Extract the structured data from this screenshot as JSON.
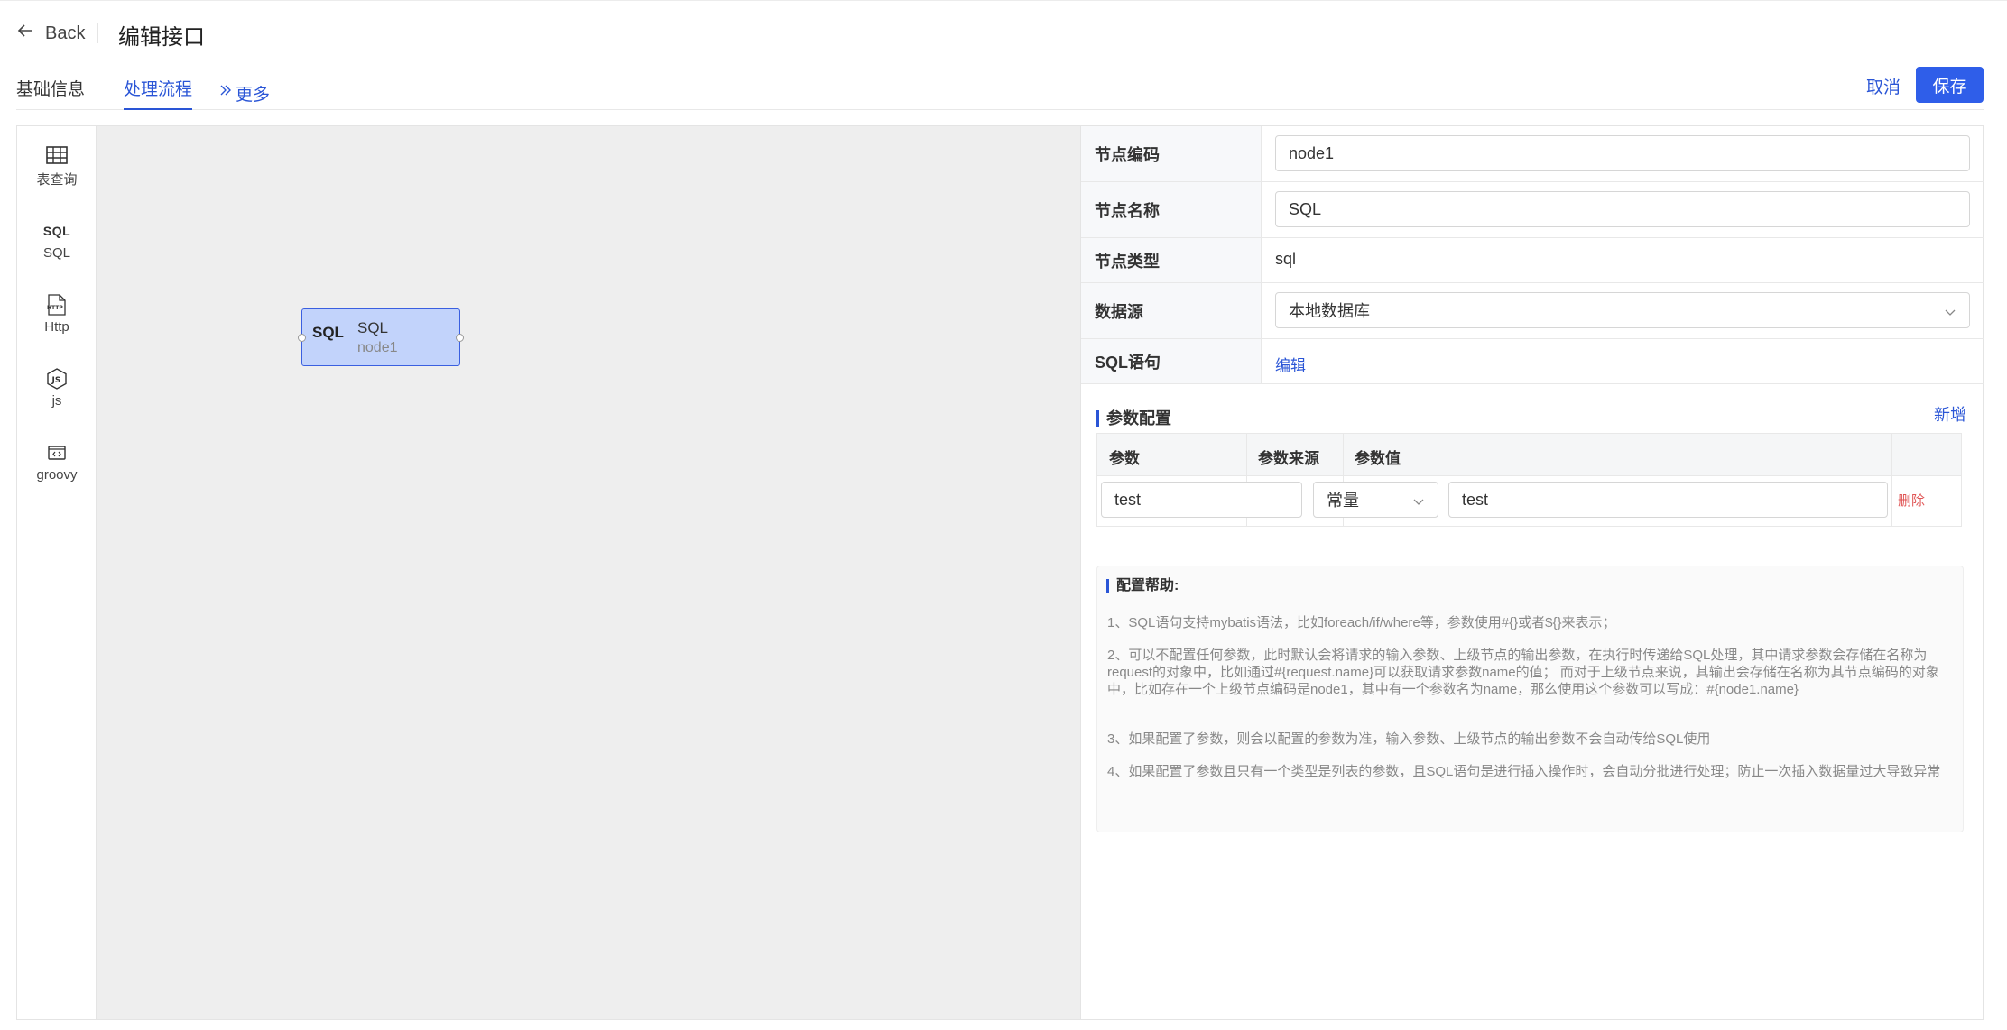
{
  "header": {
    "back_label": "Back",
    "title": "编辑接口",
    "back_icon": "arrow-left-icon"
  },
  "tabs": [
    {
      "label": "基础信息",
      "active": false
    },
    {
      "label": "处理流程",
      "active": true
    },
    {
      "label": "更多",
      "active": false,
      "icon": "double-chevron-right-icon"
    }
  ],
  "actions": {
    "cancel_label": "取消",
    "save_label": "保存"
  },
  "colors": {
    "primary": "#2f5ee9",
    "link": "#2a55d6",
    "node_fill": "#c2d3fb",
    "danger": "#e05555",
    "canvas_bg": "#eeeeee"
  },
  "palette": [
    {
      "label": "表查询",
      "icon": "table-icon"
    },
    {
      "label": "SQL",
      "icon": "sql-icon",
      "glyph": "SQL"
    },
    {
      "label": "Http",
      "icon": "http-file-icon",
      "glyph": "HTTP"
    },
    {
      "label": "js",
      "icon": "js-hexagon-icon",
      "glyph": "JS"
    },
    {
      "label": "groovy",
      "icon": "code-window-icon"
    }
  ],
  "canvas": {
    "nodes": [
      {
        "type_glyph": "SQL",
        "name": "SQL",
        "code": "node1"
      }
    ]
  },
  "form": {
    "node_code_label": "节点编码",
    "node_code_value": "node1",
    "node_name_label": "节点名称",
    "node_name_value": "SQL",
    "node_type_label": "节点类型",
    "node_type_value": "sql",
    "datasource_label": "数据源",
    "datasource_value": "本地数据库",
    "sql_label": "SQL语句",
    "sql_edit_label": "编辑"
  },
  "params": {
    "section_title": "参数配置",
    "add_label": "新增",
    "columns": [
      "参数",
      "参数来源",
      "参数值"
    ],
    "rows": [
      {
        "name": "test",
        "source": "常量",
        "value": "test",
        "delete_label": "删除"
      }
    ]
  },
  "help": {
    "title": "配置帮助:",
    "items": [
      "1、SQL语句支持mybatis语法，比如foreach/if/where等，参数使用#{}或者${}来表示；",
      "2、可以不配置任何参数，此时默认会将请求的输入参数、上级节点的输出参数，在执行时传递给SQL处理，其中请求参数会存储在名称为request的对象中，比如通过#{request.name}可以获取请求参数name的值； 而对于上级节点来说，其输出会存储在名称为其节点编码的对象中，比如存在一个上级节点编码是node1，其中有一个参数名为name，那么使用这个参数可以写成：#{node1.name}",
      "3、如果配置了参数，则会以配置的参数为准，输入参数、上级节点的输出参数不会自动传给SQL使用",
      "4、如果配置了参数且只有一个类型是列表的参数，且SQL语句是进行插入操作时，会自动分批进行处理；防止一次插入数据量过大导致异常"
    ]
  }
}
